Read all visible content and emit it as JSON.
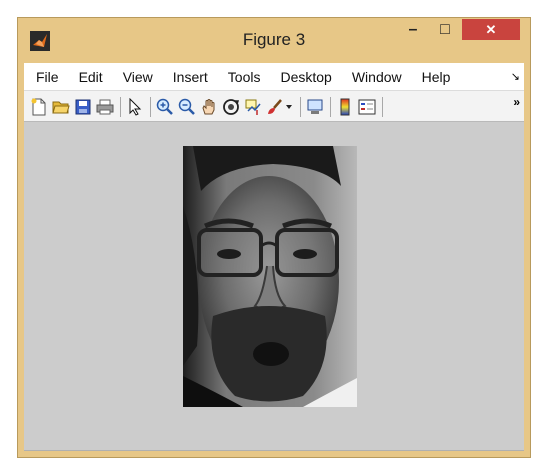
{
  "window": {
    "title": "Figure 3",
    "controls": {
      "minimize": "–",
      "maximize": "□",
      "close": "✕"
    }
  },
  "menu": {
    "items": [
      "File",
      "Edit",
      "View",
      "Insert",
      "Tools",
      "Desktop",
      "Window",
      "Help"
    ],
    "overflow": "↘"
  },
  "toolbar": {
    "tools": [
      {
        "icon": "new-figure-icon"
      },
      {
        "icon": "open-file-icon"
      },
      {
        "icon": "save-icon"
      },
      {
        "icon": "print-icon"
      },
      {
        "icon": "pointer-icon"
      },
      {
        "icon": "zoom-in-icon"
      },
      {
        "icon": "zoom-out-icon"
      },
      {
        "icon": "pan-hand-icon"
      },
      {
        "icon": "rotate-3d-icon"
      },
      {
        "icon": "data-cursor-icon"
      },
      {
        "icon": "brush-icon"
      },
      {
        "icon": "link-plot-icon"
      },
      {
        "icon": "colorbar-icon"
      },
      {
        "icon": "legend-icon"
      }
    ],
    "overflow": "»"
  },
  "colors": {
    "frame": "#e7c787",
    "close_button": "#c9443e",
    "canvas": "#cccccc"
  }
}
